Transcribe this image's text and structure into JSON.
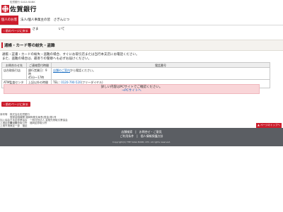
{
  "header": {
    "sub": "佐賀銀行 SAGA BANK",
    "bank_name": "佐賀銀行",
    "nav": [
      "個人のお客さま",
      "法人/個人事業主の皆さま",
      "さぎんについて"
    ]
  },
  "back_button": "前のページに戻る",
  "section_title": "通帳・カード等の紛失・盗難",
  "intro": [
    "通帳・証書・カードの紛失・盗難の場合、すぐにお取引店または当行本支店にお電話ください。",
    "また、盗難の場合は、最寄りの警察へも必ずお届けください。"
  ],
  "table": {
    "headers": [
      "お問合わせ先",
      "ご連絡受付時間",
      "電話番号"
    ],
    "rows": [
      {
        "place": "店台取扱引店",
        "hours": [
          "銀行営業日：9時",
          "45分～17時"
        ],
        "link": "店舗のご案内",
        "phone_suffix": "から電話ください。"
      },
      {
        "place": "ATM監査センター",
        "hours": [
          "上記以外の時間",
          "帯"
        ],
        "tel_label": "TEL：",
        "tel": "0120-790-520",
        "tel_suffix": "(フリーダイヤル)"
      }
    ]
  },
  "notice": {
    "line1": "詳しい内容はPCサイトでご確認ください。",
    "line2": "→PCサイトへ"
  },
  "info": [
    {
      "label": "商号等",
      "value": "株式会社佐賀銀行"
    },
    {
      "label": "",
      "value": "登録金融機関 福岡財務支局長(登金)第1号"
    },
    {
      "label": "加入協会",
      "value": "日本証券業協会　一般社団法人 金融先物取引業協会"
    },
    {
      "label": "上場証券取引所",
      "value": "東京証券取引所　福岡証券取引所"
    },
    {
      "label": "上場市場",
      "value": "東証一部　福証"
    }
  ],
  "pagetop": "ページのトップへ",
  "footer": {
    "line1": "店舗検索　|　お問合せ・ご意見",
    "line2": "ご利用条件　|　個人情報保護方針",
    "copyright": "Copyright(C) THE SAGA BANK, LTD. All rights reserved."
  },
  "colors": {
    "brand": "#cc1d2c",
    "notice_bg": "#f9d5d8",
    "footer_bg": "#5b5e63",
    "link": "#1a6dc0"
  }
}
